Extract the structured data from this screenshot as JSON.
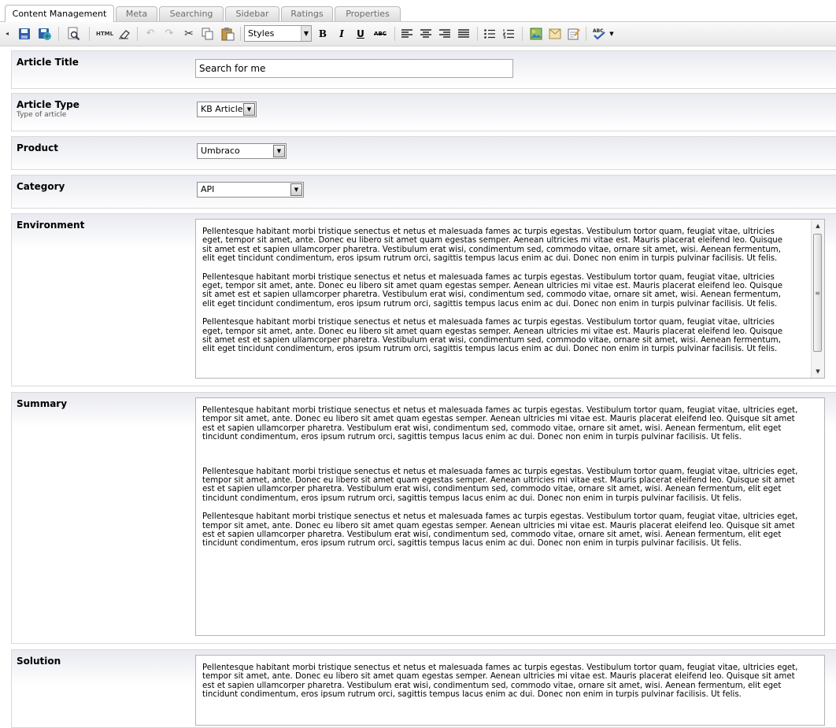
{
  "tabs": [
    {
      "label": "Content Management",
      "active": true
    },
    {
      "label": "Meta"
    },
    {
      "label": "Searching"
    },
    {
      "label": "Sidebar"
    },
    {
      "label": "Ratings"
    },
    {
      "label": "Properties"
    }
  ],
  "toolbar": {
    "styles_label": "Styles",
    "html_label": "HTML",
    "bold": "B",
    "italic": "I",
    "underline": "U",
    "strike": "ABC",
    "spell": "ABC"
  },
  "fields": {
    "article_title": {
      "label": "Article Title",
      "value": "Search for me"
    },
    "article_type": {
      "label": "Article Type",
      "description": "Type of article",
      "value": "KB Article"
    },
    "product": {
      "label": "Product",
      "value": "Umbraco"
    },
    "category": {
      "label": "Category",
      "value": "API"
    },
    "environment": {
      "label": "Environment",
      "paragraphs": [
        "Pellentesque habitant morbi tristique senectus et netus et malesuada fames ac turpis egestas. Vestibulum tortor quam, feugiat vitae, ultricies eget, tempor sit amet, ante. Donec eu libero sit amet quam egestas semper. Aenean ultricies mi vitae est. Mauris placerat eleifend leo. Quisque sit amet est et sapien ullamcorper pharetra. Vestibulum erat wisi, condimentum sed, commodo vitae, ornare sit amet, wisi. Aenean fermentum, elit eget tincidunt condimentum, eros ipsum rutrum orci, sagittis tempus lacus enim ac dui. Donec non enim in turpis pulvinar facilisis. Ut felis.",
        "Pellentesque habitant morbi tristique senectus et netus et malesuada fames ac turpis egestas. Vestibulum tortor quam, feugiat vitae, ultricies eget, tempor sit amet, ante. Donec eu libero sit amet quam egestas semper. Aenean ultricies mi vitae est. Mauris placerat eleifend leo. Quisque sit amet est et sapien ullamcorper pharetra. Vestibulum erat wisi, condimentum sed, commodo vitae, ornare sit amet, wisi. Aenean fermentum, elit eget tincidunt condimentum, eros ipsum rutrum orci, sagittis tempus lacus enim ac dui. Donec non enim in turpis pulvinar facilisis. Ut felis.",
        "Pellentesque habitant morbi tristique senectus et netus et malesuada fames ac turpis egestas. Vestibulum tortor quam, feugiat vitae, ultricies eget, tempor sit amet, ante. Donec eu libero sit amet quam egestas semper. Aenean ultricies mi vitae est. Mauris placerat eleifend leo. Quisque sit amet est et sapien ullamcorper pharetra. Vestibulum erat wisi, condimentum sed, commodo vitae, ornare sit amet, wisi. Aenean fermentum, elit eget tincidunt condimentum, eros ipsum rutrum orci, sagittis tempus lacus enim ac dui. Donec non enim in turpis pulvinar facilisis. Ut felis."
      ]
    },
    "summary": {
      "label": "Summary",
      "paragraphs": [
        "Pellentesque habitant morbi tristique senectus et netus et malesuada fames ac turpis egestas. Vestibulum tortor quam, feugiat vitae, ultricies eget, tempor sit amet, ante. Donec eu libero sit amet quam egestas semper. Aenean ultricies mi vitae est. Mauris placerat eleifend leo. Quisque sit amet est et sapien ullamcorper pharetra. Vestibulum erat wisi, condimentum sed, commodo vitae, ornare sit amet, wisi. Aenean fermentum, elit eget tincidunt condimentum, eros ipsum rutrum orci, sagittis tempus lacus enim ac dui. Donec non enim in turpis pulvinar facilisis. Ut felis.",
        "Pellentesque habitant morbi tristique senectus et netus et malesuada fames ac turpis egestas. Vestibulum tortor quam, feugiat vitae, ultricies eget, tempor sit amet, ante. Donec eu libero sit amet quam egestas semper. Aenean ultricies mi vitae est. Mauris placerat eleifend leo. Quisque sit amet est et sapien ullamcorper pharetra. Vestibulum erat wisi, condimentum sed, commodo vitae, ornare sit amet, wisi. Aenean fermentum, elit eget tincidunt condimentum, eros ipsum rutrum orci, sagittis tempus lacus enim ac dui. Donec non enim in turpis pulvinar facilisis. Ut felis.",
        "Pellentesque habitant morbi tristique senectus et netus et malesuada fames ac turpis egestas. Vestibulum tortor quam, feugiat vitae, ultricies eget, tempor sit amet, ante. Donec eu libero sit amet quam egestas semper. Aenean ultricies mi vitae est. Mauris placerat eleifend leo. Quisque sit amet est et sapien ullamcorper pharetra. Vestibulum erat wisi, condimentum sed, commodo vitae, ornare sit amet, wisi. Aenean fermentum, elit eget tincidunt condimentum, eros ipsum rutrum orci, sagittis tempus lacus enim ac dui. Donec non enim in turpis pulvinar facilisis. Ut felis."
      ]
    },
    "solution": {
      "label": "Solution",
      "paragraphs": [
        "Pellentesque habitant morbi tristique senectus et netus et malesuada fames ac turpis egestas. Vestibulum tortor quam, feugiat vitae, ultricies eget, tempor sit amet, ante. Donec eu libero sit amet quam egestas semper. Aenean ultricies mi vitae est. Mauris placerat eleifend leo. Quisque sit amet est et sapien ullamcorper pharetra. Vestibulum erat wisi, condimentum sed, commodo vitae, ornare sit amet, wisi. Aenean fermentum, elit eget tincidunt condimentum, eros ipsum rutrum orci, sagittis tempus lacus enim ac dui. Donec non enim in turpis pulvinar facilisis. Ut felis."
      ]
    }
  },
  "colors": {
    "accent_blue": "#1f5aa6",
    "row_gradient_top": "#e9eaf0",
    "border": "#d9d9d9"
  }
}
